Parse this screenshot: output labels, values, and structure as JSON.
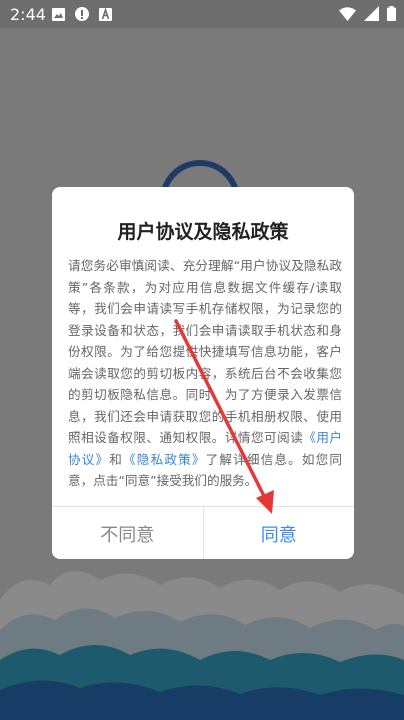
{
  "status_bar": {
    "time": "2:44"
  },
  "dialog": {
    "title": "用户协议及隐私政策",
    "content": {
      "part1": "请您务必审慎阅读、充分理解“用户协议及隐私政策”各条款，为对应用信息数据文件缓存/读取等，我们会申请读写手机存储权限，为记录您的登录设备和状态，我们会申请读取手机状态和身份权限。为了给您提供快捷填写信息功能，客户端会读取您的剪切板内容，系统后台不会收集您的剪切板隐私信息。同时，为了方便录入发票信息，我们还会申请获取您的手机相册权限、使用照相设备权限、通知权限。详情您可阅读",
      "link1": "《用户协议》",
      "and": "和",
      "link2": "《隐私政策》",
      "part2": "了解详细信息。如您同意，点击“同意”接受我们的服务。"
    },
    "buttons": {
      "disagree": "不同意",
      "agree": "同意"
    }
  },
  "colors": {
    "agree": "#3a8be8",
    "link": "#3a86d8",
    "arrow": "#e53935"
  }
}
